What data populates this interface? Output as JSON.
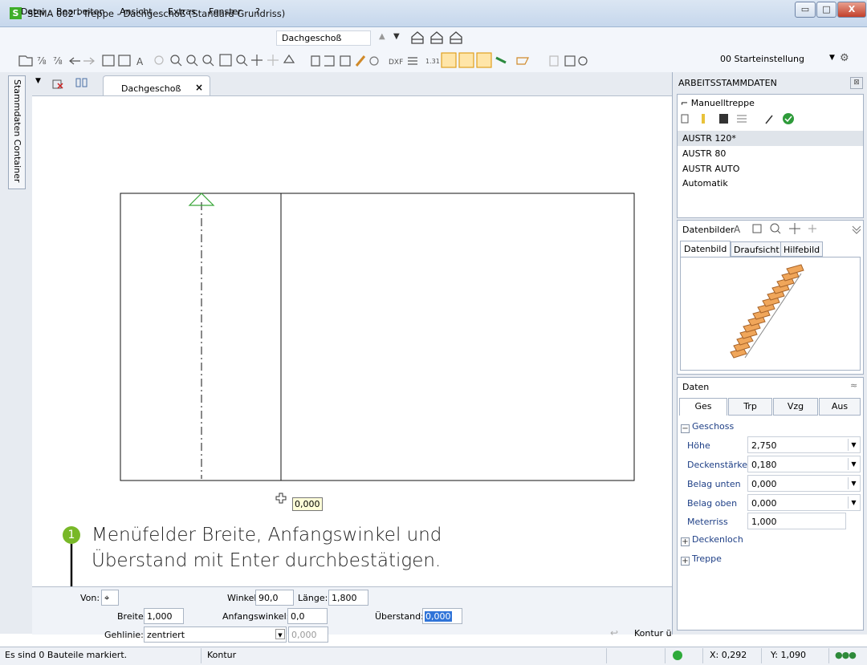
{
  "window": {
    "title": "SEMA  002 - Treppe  - Dachgeschoß (Standard Grundriss)",
    "app_icon": "S",
    "controls": {
      "minimize": "▭",
      "maximize": "□",
      "close": "X"
    }
  },
  "menubar": {
    "items": [
      "Datei",
      "Bearbeiten",
      "Ansicht",
      "Extras",
      "Fenster",
      "?"
    ],
    "floor_combo": "Dachgeschoß"
  },
  "toolbar": {
    "start_combo": "00 Starteinstellung"
  },
  "left_strip": {
    "container_tab": "Stammdaten Container"
  },
  "doc_tab": {
    "label": "Dachgeschoß",
    "close": "×"
  },
  "canvas": {
    "cursor_value": "0,000"
  },
  "annotation": {
    "number": "1",
    "line1": "Menüfelder Breite, Anfangswinkel und",
    "line2": "Überstand mit Enter durchbestätigen."
  },
  "panel": {
    "title": "ARBEITSSTAMMDATEN",
    "close": "⊠",
    "manual": "Manuelltreppe",
    "list": [
      "AUSTR 120*",
      "AUSTR 80",
      "AUSTR AUTO",
      "Automatik"
    ],
    "datenbilder_label": "Datenbilder",
    "datenbilder_tabs": [
      "Datenbild",
      "Draufsicht",
      "Hilfebild"
    ],
    "daten_label": "Daten",
    "daten_tabs": [
      "Ges",
      "Trp",
      "Vzg",
      "Aus"
    ],
    "sections": {
      "geschoss": "Geschoss",
      "deckenloch": "Deckenloch",
      "treppe": "Treppe"
    },
    "props": [
      {
        "label": "Höhe",
        "value": "2,750"
      },
      {
        "label": "Deckenstärke",
        "value": "0,180"
      },
      {
        "label": "Belag unten",
        "value": "0,000"
      },
      {
        "label": "Belag oben",
        "value": "0,000"
      },
      {
        "label": "Meterriss",
        "value": "1,000"
      }
    ]
  },
  "bottom": {
    "von_label": "Von:",
    "breite_label": "Breite:",
    "breite_value": "1,000",
    "gehlinie_label": "Gehlinie:",
    "gehlinie_value": "zentriert",
    "gehlinie_extra": "0,000",
    "winkel_label": "Winkel:",
    "winkel_value": "90,0",
    "laenge_label": "Länge:",
    "laenge_value": "1,800",
    "anfangswinkel_label": "Anfangswinkel:",
    "anfangswinkel_value": "0,0",
    "ueberstand_label": "Überstand:",
    "ueberstand_value": "0,000",
    "kontur_label": "Kontur ü"
  },
  "status": {
    "message": "Es sind 0 Bauteile markiert.",
    "mode": "Kontur",
    "x": "X:  0,292",
    "y": "Y:  1,090"
  }
}
